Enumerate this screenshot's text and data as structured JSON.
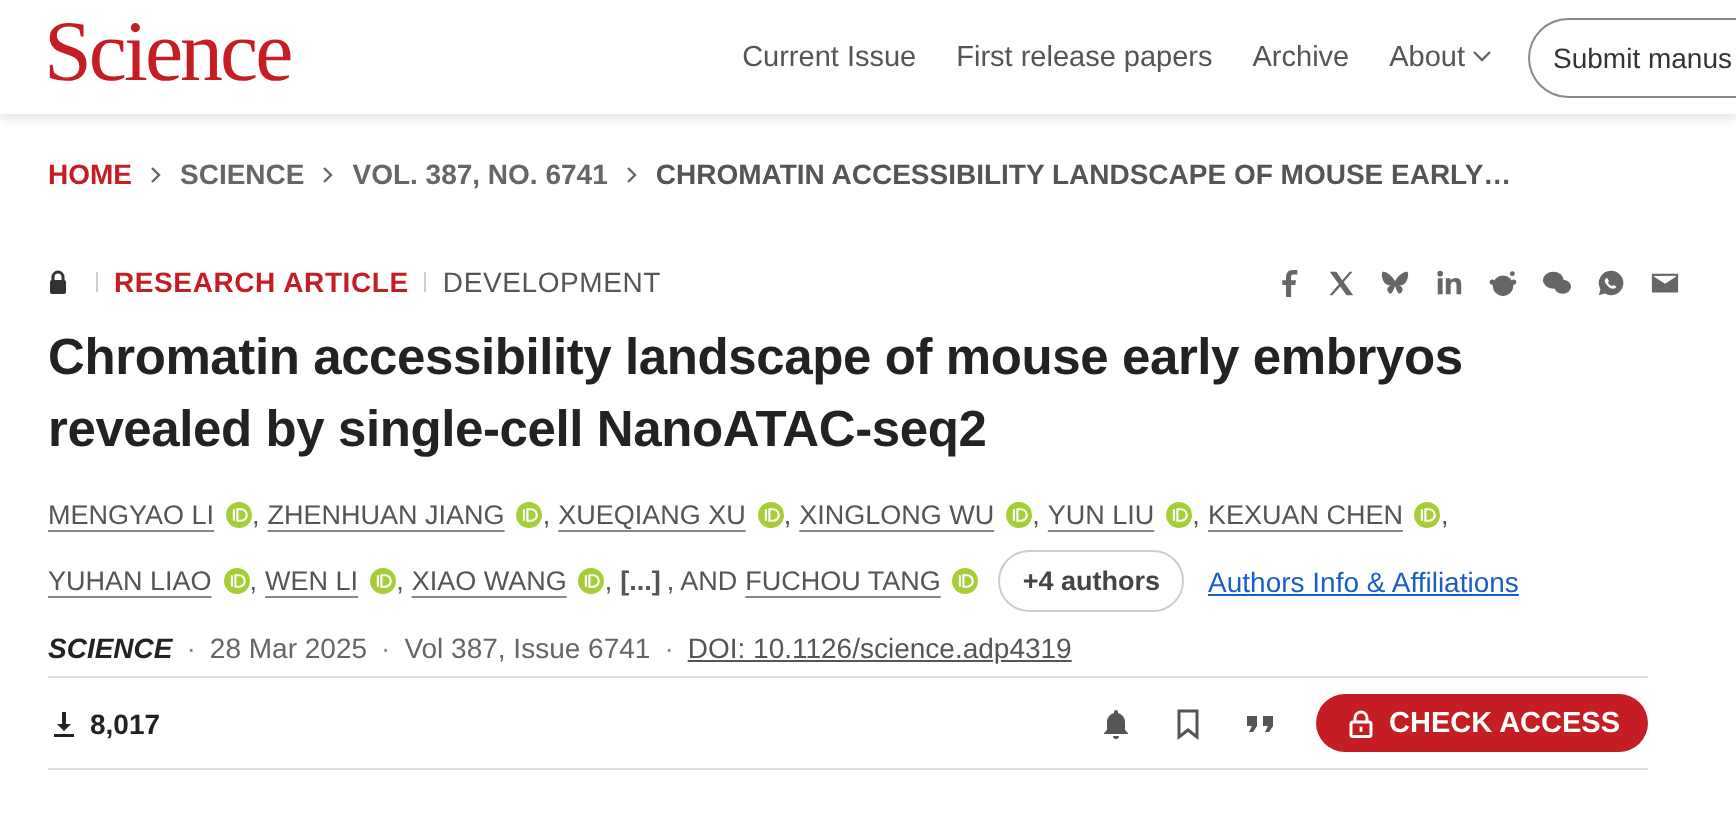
{
  "header": {
    "logo": "Science",
    "nav": [
      {
        "label": "Current Issue",
        "kind": "link"
      },
      {
        "label": "First release papers",
        "kind": "link"
      },
      {
        "label": "Archive",
        "kind": "link"
      },
      {
        "label": "About",
        "kind": "dropdown"
      }
    ],
    "submit_button": "Submit manus"
  },
  "breadcrumb": [
    {
      "label": "HOME",
      "kind": "home"
    },
    {
      "label": "SCIENCE",
      "kind": "crumb"
    },
    {
      "label": "VOL. 387, NO. 6741",
      "kind": "crumb"
    },
    {
      "label": "CHROMATIN ACCESSIBILITY LANDSCAPE OF MOUSE EARLY…",
      "kind": "current"
    }
  ],
  "article": {
    "locked": true,
    "type": "RESEARCH ARTICLE",
    "section": "DEVELOPMENT",
    "title": "Chromatin accessibility landscape of mouse early embryos revealed by single-cell NanoATAC-seq2",
    "authors": [
      {
        "kind": "author",
        "name": "MENGYAO LI",
        "orcid": true,
        "suffix": ","
      },
      {
        "kind": "author",
        "name": "ZHENHUAN JIANG",
        "orcid": true,
        "suffix": ","
      },
      {
        "kind": "author",
        "name": "XUEQIANG XU",
        "orcid": true,
        "suffix": ","
      },
      {
        "kind": "author",
        "name": "XINGLONG WU",
        "orcid": true,
        "suffix": ","
      },
      {
        "kind": "author",
        "name": "YUN LIU",
        "orcid": true,
        "suffix": ","
      },
      {
        "kind": "author",
        "name": "KEXUAN CHEN",
        "orcid": true,
        "suffix": ","
      },
      {
        "kind": "author",
        "name": "YUHAN LIAO",
        "orcid": true,
        "suffix": ","
      },
      {
        "kind": "author",
        "name": "WEN LI",
        "orcid": true,
        "suffix": ","
      },
      {
        "kind": "author",
        "name": "XIAO WANG",
        "orcid": true,
        "suffix": ","
      },
      {
        "kind": "elided",
        "name": "[...]",
        "suffix": ", AND"
      },
      {
        "kind": "author",
        "name": "FUCHOU TANG",
        "orcid": true
      }
    ],
    "more_authors": "+4 authors",
    "affiliations_link": "Authors Info & Affiliations",
    "journal": "SCIENCE",
    "separator": "·",
    "date": "28 Mar 2025",
    "volume": "Vol 387, Issue 6741",
    "doi": "DOI: 10.1126/science.adp4319",
    "downloads": "8,017",
    "access_button": "CHECK ACCESS"
  }
}
